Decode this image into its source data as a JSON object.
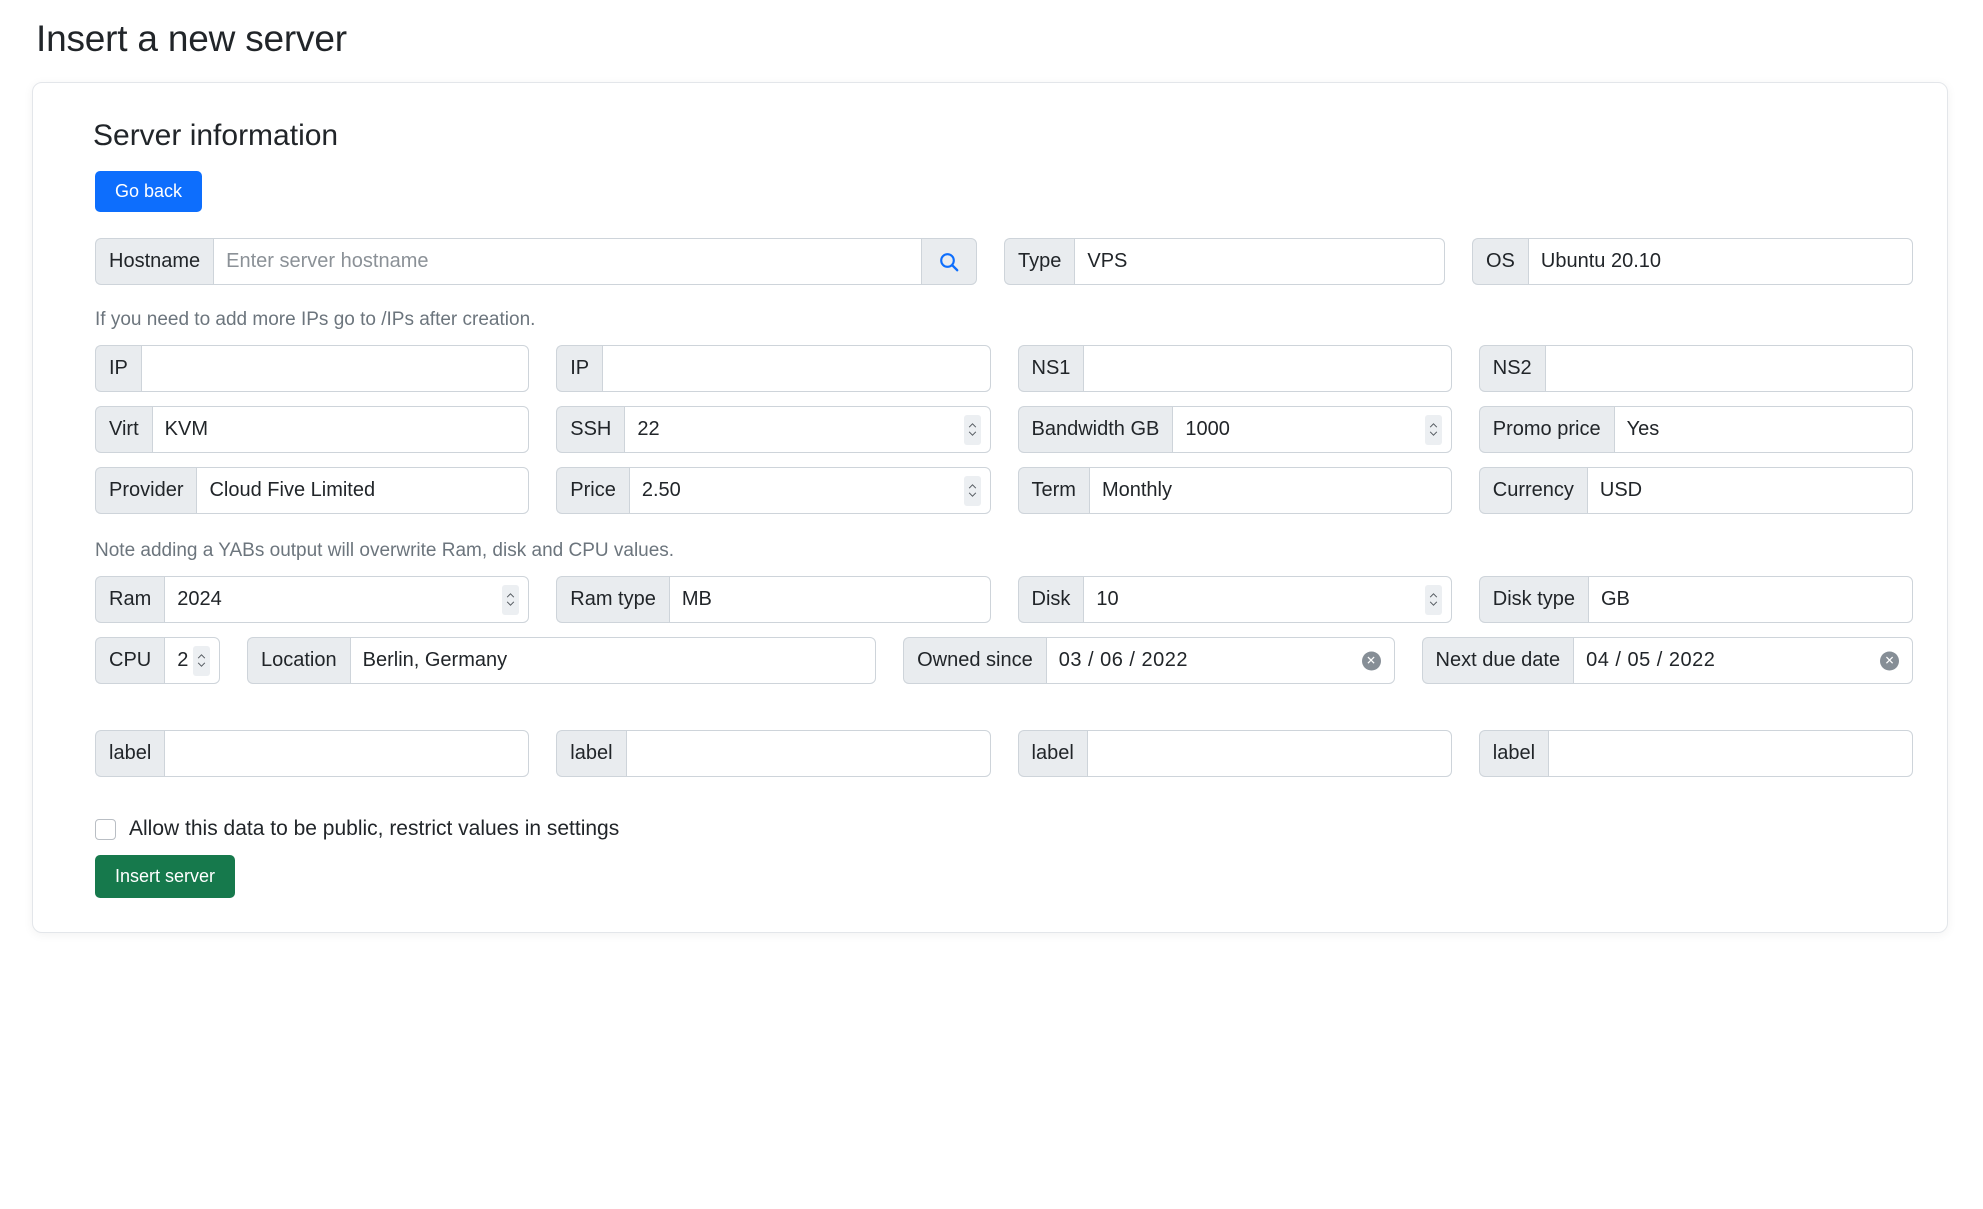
{
  "page": {
    "title": "Insert a new server"
  },
  "card": {
    "title": "Server information",
    "go_back_label": "Go back",
    "submit_label": "Insert server",
    "hint_ips": "If you need to add more IPs go to /IPs after creation.",
    "hint_yabs": "Note adding a YABs output will overwrite Ram, disk and CPU values.",
    "public_checkbox_label": "Allow this data to be public, restrict values in settings",
    "public_checkbox_checked": false
  },
  "icons": {
    "search": "search-icon",
    "spinner": "stepper-icon",
    "date_clear": "clear-date-icon"
  },
  "colors": {
    "primary_blue": "#0d6efd",
    "submit_green": "#16794c",
    "label_bg": "#e9ecef",
    "border": "#ced4da",
    "muted_text": "#6c757d"
  },
  "fields": {
    "hostname": {
      "label": "Hostname",
      "value": "",
      "placeholder": "Enter server hostname"
    },
    "type": {
      "label": "Type",
      "value": "VPS"
    },
    "os": {
      "label": "OS",
      "value": "Ubuntu 20.10"
    },
    "ip1": {
      "label": "IP",
      "value": ""
    },
    "ip2": {
      "label": "IP",
      "value": ""
    },
    "ns1": {
      "label": "NS1",
      "value": ""
    },
    "ns2": {
      "label": "NS2",
      "value": ""
    },
    "virt": {
      "label": "Virt",
      "value": "KVM"
    },
    "ssh": {
      "label": "SSH",
      "value": "22"
    },
    "bandwidth": {
      "label": "Bandwidth GB",
      "value": "1000"
    },
    "promo_price": {
      "label": "Promo price",
      "value": "Yes"
    },
    "provider": {
      "label": "Provider",
      "value": "Cloud Five Limited"
    },
    "price": {
      "label": "Price",
      "value": "2.50"
    },
    "term": {
      "label": "Term",
      "value": "Monthly"
    },
    "currency": {
      "label": "Currency",
      "value": "USD"
    },
    "ram": {
      "label": "Ram",
      "value": "2024"
    },
    "ram_type": {
      "label": "Ram type",
      "value": "MB"
    },
    "disk": {
      "label": "Disk",
      "value": "10"
    },
    "disk_type": {
      "label": "Disk type",
      "value": "GB"
    },
    "cpu": {
      "label": "CPU",
      "value": "2"
    },
    "location": {
      "label": "Location",
      "value": "Berlin, Germany"
    },
    "owned_since": {
      "label": "Owned since",
      "value": "03 / 06 / 2022"
    },
    "next_due_date": {
      "label": "Next due date",
      "value": "04 / 05 / 2022"
    },
    "label1": {
      "label": "label",
      "value": ""
    },
    "label2": {
      "label": "label",
      "value": ""
    },
    "label3": {
      "label": "label",
      "value": ""
    },
    "label4": {
      "label": "label",
      "value": ""
    }
  }
}
